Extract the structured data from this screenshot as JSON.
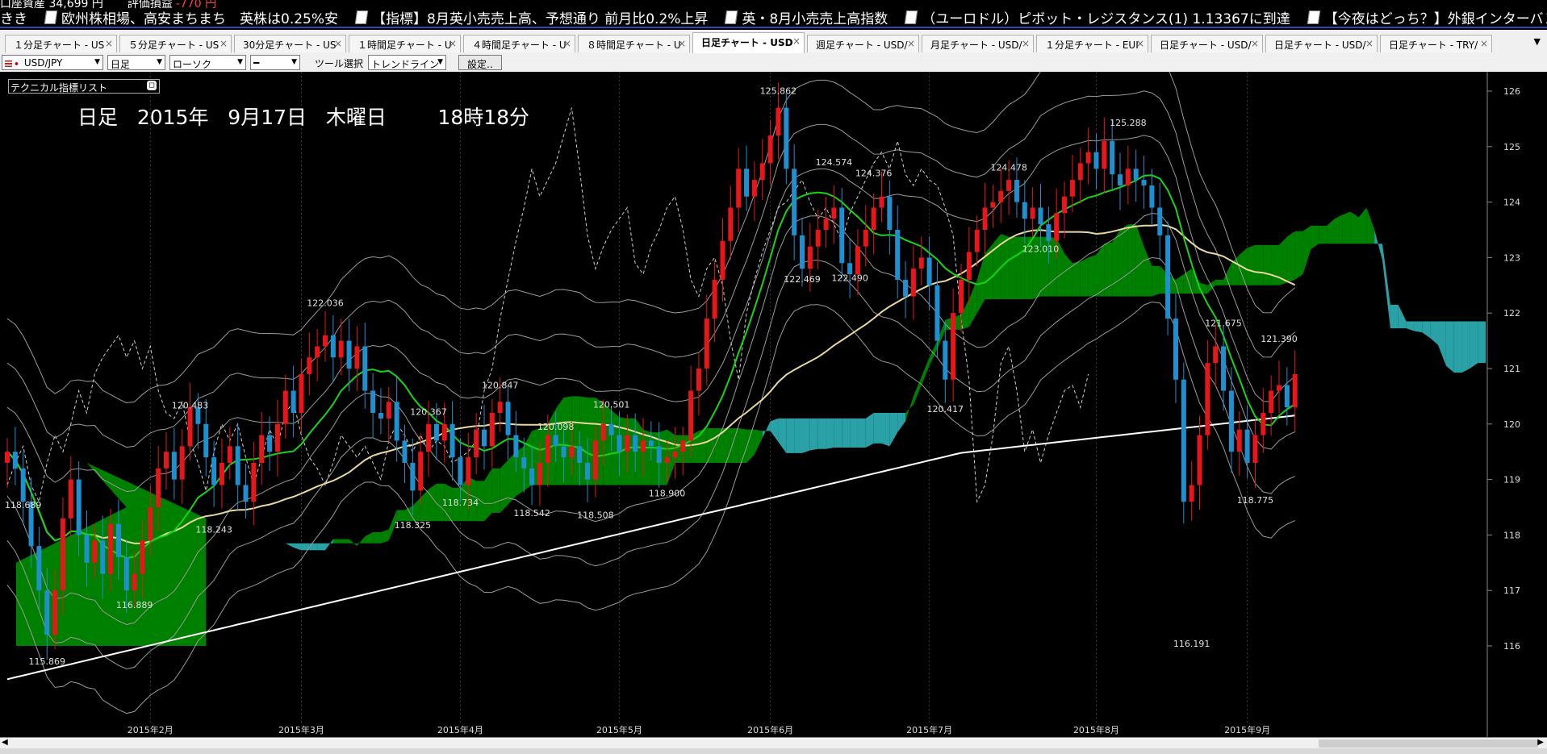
{
  "ticker": {
    "top_row": [
      {
        "text": "口座資産  34,699 円",
        "neg": false
      },
      {
        "text": "評価損益",
        "neg": false
      },
      {
        "text": "-770 円",
        "neg": true
      }
    ],
    "headlines": [
      "欧州株相場、高安まちまち　英株は0.25%安",
      "【指標】8月英小売売上高、予想通り 前月比0.2%上昇",
      "英・8月小売売上高指数",
      "（ユーロドル）ピボット・レジスタンス(1)  1.13367に到達",
      "【今夜はどっち？】外銀インターバンク"
    ],
    "left_fragment": "きき"
  },
  "tabs": [
    "１分足チャート - US",
    "５分足チャート - US",
    "30分足チャート - US",
    "１時間足チャート - U",
    "４時間足チャート - U",
    "８時間足チャート - U",
    "日足チャート - USD",
    "週足チャート - USD/",
    "月足チャート - USD/",
    "１分足チャート - EUI",
    "日足チャート - USD/",
    "日足チャート - USD/",
    "日足チャート - TRY/"
  ],
  "active_tab_index": 6,
  "tab_close": "×",
  "tab_menu": "▼",
  "toolbar": {
    "pair": "USD/JPY",
    "timeframe": "日足",
    "chart_style": "ローソク",
    "line_style": "━",
    "tool_label": "ツール選択",
    "tool_value": "トレンドライン",
    "settings": "設定..",
    "arrow": "▼"
  },
  "indicator_list_label": "テクニカル指標リスト",
  "date_display": "日足   2015年   9月17日   木曜日        18時18分",
  "colors": {
    "up_candle": "#e8161b",
    "down_candle": "#1e90d0",
    "kumo_green": "#008000",
    "kumo_teal": "#2aa1a6",
    "sma_green": "#18d418",
    "sma_yellow": "#e8d8a0",
    "sma_white": "#ffffff",
    "tab_bar_blue": "#2a4dbb"
  },
  "chart_data": {
    "type": "candlestick",
    "symbol": "USD/JPY",
    "ylim": [
      115.5,
      126.3
    ],
    "y_ticks": [
      116,
      117,
      118,
      119,
      120,
      121,
      122,
      123,
      124,
      125,
      126
    ],
    "x_months": [
      "2015年2月",
      "2015年3月",
      "2015年4月",
      "2015年5月",
      "2015年6月",
      "2015年7月",
      "2015年8月",
      "2015年9月"
    ],
    "month_index": [
      18,
      37,
      57,
      77,
      96,
      116,
      137,
      156
    ],
    "annotations": [
      {
        "i": 2,
        "v": 118.689,
        "label": "118.689"
      },
      {
        "i": 5,
        "v": 115.869,
        "label": "115.869"
      },
      {
        "i": 16,
        "v": 116.889,
        "label": "116.889"
      },
      {
        "i": 23,
        "v": 120.483,
        "label": "120.483"
      },
      {
        "i": 26,
        "v": 118.243,
        "label": "118.243"
      },
      {
        "i": 40,
        "v": 122.036,
        "label": "122.036"
      },
      {
        "i": 51,
        "v": 118.325,
        "label": "118.325"
      },
      {
        "i": 53,
        "v": 120.367,
        "label": "120.367"
      },
      {
        "i": 57,
        "v": 118.734,
        "label": "118.734"
      },
      {
        "i": 62,
        "v": 120.847,
        "label": "120.847"
      },
      {
        "i": 69,
        "v": 120.098,
        "label": "120.098"
      },
      {
        "i": 66,
        "v": 118.542,
        "label": "118.542"
      },
      {
        "i": 74,
        "v": 118.508,
        "label": "118.508"
      },
      {
        "i": 76,
        "v": 120.501,
        "label": "120.501"
      },
      {
        "i": 83,
        "v": 118.9,
        "label": "118.900"
      },
      {
        "i": 97,
        "v": 125.862,
        "label": "125.862"
      },
      {
        "i": 100,
        "v": 122.469,
        "label": "122.469"
      },
      {
        "i": 104,
        "v": 124.574,
        "label": "124.574"
      },
      {
        "i": 106,
        "v": 122.49,
        "label": "122.490"
      },
      {
        "i": 109,
        "v": 124.376,
        "label": "124.376"
      },
      {
        "i": 118,
        "v": 120.417,
        "label": "120.417"
      },
      {
        "i": 126,
        "v": 124.478,
        "label": "124.478"
      },
      {
        "i": 130,
        "v": 123.01,
        "label": "123.010"
      },
      {
        "i": 141,
        "v": 125.288,
        "label": "125.288"
      },
      {
        "i": 149,
        "v": 116.191,
        "label": "116.191"
      },
      {
        "i": 153,
        "v": 121.675,
        "label": "121.675"
      },
      {
        "i": 157,
        "v": 118.775,
        "label": "118.775"
      },
      {
        "i": 160,
        "v": 121.39,
        "label": "121.390"
      }
    ],
    "series": [
      {
        "name": "close",
        "values": [
          119.5,
          119.2,
          118.6,
          117.8,
          117.0,
          116.2,
          117.0,
          118.3,
          119.0,
          118.0,
          117.5,
          117.9,
          117.3,
          118.2,
          117.6,
          117.0,
          117.3,
          117.9,
          118.5,
          119.2,
          119.5,
          119.0,
          119.6,
          120.3,
          120.0,
          119.4,
          118.9,
          119.3,
          119.6,
          118.9,
          118.6,
          119.3,
          119.8,
          119.5,
          120.0,
          120.6,
          120.2,
          120.9,
          121.2,
          121.4,
          121.6,
          121.2,
          121.5,
          121.0,
          121.4,
          120.6,
          120.2,
          120.1,
          120.4,
          119.7,
          119.3,
          118.8,
          119.5,
          120.0,
          119.7,
          120.0,
          119.4,
          118.9,
          119.4,
          119.9,
          119.6,
          120.2,
          120.4,
          119.8,
          119.4,
          119.2,
          118.9,
          119.3,
          119.8,
          119.6,
          119.4,
          119.6,
          119.3,
          119.0,
          119.7,
          120.0,
          119.8,
          119.5,
          119.8,
          119.5,
          119.7,
          119.6,
          119.3,
          119.4,
          119.5,
          119.7,
          120.6,
          121.0,
          121.9,
          122.6,
          123.3,
          123.9,
          124.6,
          124.1,
          124.4,
          124.7,
          125.2,
          125.7,
          124.6,
          123.4,
          122.8,
          123.2,
          123.5,
          123.7,
          123.9,
          122.9,
          122.7,
          123.2,
          123.5,
          123.9,
          124.1,
          123.5,
          122.6,
          122.3,
          122.8,
          123.0,
          122.5,
          121.5,
          120.8,
          122.0,
          122.6,
          123.1,
          123.5,
          123.9,
          124.0,
          124.2,
          124.4,
          124.0,
          123.7,
          123.9,
          123.6,
          123.3,
          123.8,
          124.1,
          124.4,
          124.7,
          124.9,
          124.6,
          125.1,
          124.5,
          124.3,
          124.6,
          124.4,
          124.3,
          123.9,
          123.4,
          121.9,
          120.8,
          118.6,
          118.9,
          119.8,
          121.1,
          121.4,
          120.6,
          119.5,
          119.9,
          119.3,
          119.8,
          120.2,
          120.6,
          120.7,
          120.3,
          120.9
        ]
      }
    ]
  }
}
